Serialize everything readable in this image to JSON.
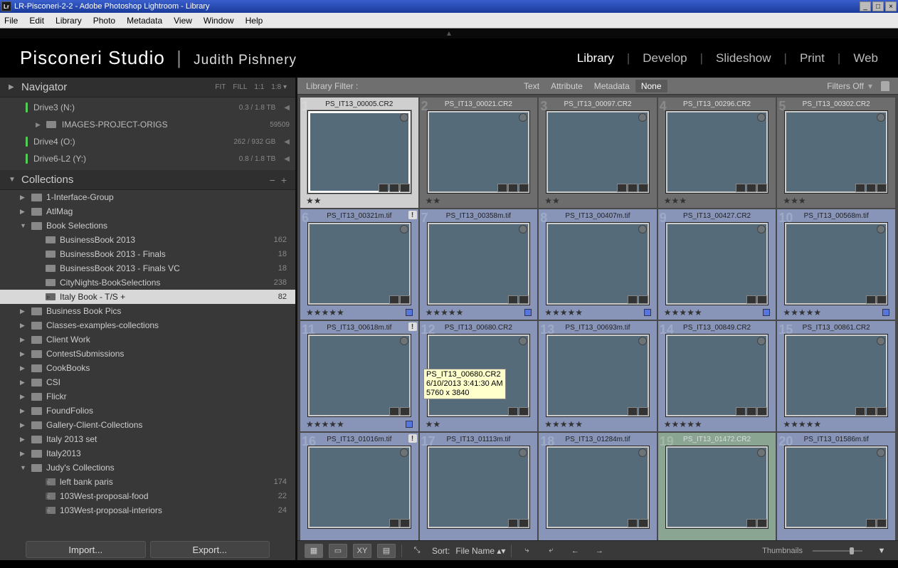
{
  "window": {
    "title": "LR-Pisconeri-2-2 - Adobe Photoshop Lightroom - Library",
    "logo": "Lr"
  },
  "menu": [
    "File",
    "Edit",
    "Library",
    "Photo",
    "Metadata",
    "View",
    "Window",
    "Help"
  ],
  "header": {
    "studio": "Pisconeri Studio",
    "author": "Judith Pishnery"
  },
  "modules": [
    "Library",
    "Develop",
    "Slideshow",
    "Print",
    "Web"
  ],
  "navigator": {
    "title": "Navigator",
    "opts": [
      "FIT",
      "FILL",
      "1:1",
      "1:8"
    ]
  },
  "drives": [
    {
      "name": "Drive3 (N:)",
      "cap": "0.3 / 1.8 TB"
    },
    {
      "name": "IMAGES-PROJECT-ORIGS",
      "count": "59509",
      "sub": true
    },
    {
      "name": "Drive4 (O:)",
      "cap": "262 / 932 GB"
    },
    {
      "name": "Drive6-L2 (Y:)",
      "cap": "0.8 / 1.8 TB"
    }
  ],
  "collections": {
    "title": "Collections",
    "items": [
      {
        "name": "1-Interface-Group",
        "level": 0,
        "tri": "▶"
      },
      {
        "name": "AtlMag",
        "level": 0,
        "tri": "▶"
      },
      {
        "name": "Book Selections",
        "level": 0,
        "tri": "▼"
      },
      {
        "name": "BusinessBook 2013",
        "count": "162",
        "level": 1
      },
      {
        "name": "BusinessBook 2013 - Finals",
        "count": "18",
        "level": 1
      },
      {
        "name": "BusinessBook 2013 - Finals VC",
        "count": "18",
        "level": 1
      },
      {
        "name": "CityNights-BookSelections",
        "count": "238",
        "level": 1
      },
      {
        "name": "Italy Book - T/S  +",
        "count": "82",
        "level": 1,
        "sel": true
      },
      {
        "name": "Business Book Pics",
        "level": 0,
        "tri": "▶"
      },
      {
        "name": "Classes-examples-collections",
        "level": 0,
        "tri": "▶"
      },
      {
        "name": "Client Work",
        "level": 0,
        "tri": "▶"
      },
      {
        "name": "ContestSubmissions",
        "level": 0,
        "tri": "▶"
      },
      {
        "name": "CookBooks",
        "level": 0,
        "tri": "▶"
      },
      {
        "name": "CSI",
        "level": 0,
        "tri": "▶"
      },
      {
        "name": "Flickr",
        "level": 0,
        "tri": "▶"
      },
      {
        "name": "FoundFolios",
        "level": 0,
        "tri": "▶"
      },
      {
        "name": "Gallery-Client-Collections",
        "level": 0,
        "tri": "▶"
      },
      {
        "name": "Italy 2013 set",
        "level": 0,
        "tri": "▶"
      },
      {
        "name": "Italy2013",
        "level": 0,
        "tri": "▶"
      },
      {
        "name": "Judy's Collections",
        "level": 0,
        "tri": "▼"
      },
      {
        "name": "left bank paris",
        "count": "174",
        "level": 1,
        "smart": true
      },
      {
        "name": "103West-proposal-food",
        "count": "22",
        "level": 1,
        "smart": true
      },
      {
        "name": "103West-proposal-interiors",
        "count": "24",
        "level": 1,
        "smart": true
      }
    ]
  },
  "buttons": {
    "import": "Import...",
    "export": "Export..."
  },
  "filter": {
    "label": "Library Filter :",
    "opts": [
      "Text",
      "Attribute",
      "Metadata",
      "None"
    ],
    "sel": 3,
    "off": "Filters Off"
  },
  "thumbs": [
    {
      "idx": "1",
      "fn": "PS_IT13_00005.CR2",
      "stars": 2,
      "th": "th-sky",
      "badges": 3,
      "active": true
    },
    {
      "idx": "2",
      "fn": "PS_IT13_00021.CR2",
      "stars": 2,
      "th": "th-wall",
      "badges": 3
    },
    {
      "idx": "3",
      "fn": "PS_IT13_00097.CR2",
      "stars": 2,
      "th": "th-yellow",
      "badges": 3
    },
    {
      "idx": "4",
      "fn": "PS_IT13_00296.CR2",
      "stars": 3,
      "th": "th-stone",
      "badges": 3
    },
    {
      "idx": "5",
      "fn": "PS_IT13_00302.CR2",
      "stars": 3,
      "th": "th-arch",
      "badges": 3
    },
    {
      "idx": "6",
      "fn": "PS_IT13_00321m.tif",
      "stars": 5,
      "th": "th-tree",
      "badges": 2,
      "sel": true,
      "excl": true,
      "sq": true
    },
    {
      "idx": "7",
      "fn": "PS_IT13_00358m.tif",
      "stars": 5,
      "th": "th-door",
      "badges": 2,
      "sel": true,
      "sq": true
    },
    {
      "idx": "8",
      "fn": "PS_IT13_00407m.tif",
      "stars": 5,
      "th": "th-cafe",
      "badges": 2,
      "sel": true,
      "sq": true
    },
    {
      "idx": "9",
      "fn": "PS_IT13_00427.CR2",
      "stars": 5,
      "th": "th-gold",
      "badges": 2,
      "sel": true,
      "sq": true
    },
    {
      "idx": "10",
      "fn": "PS_IT13_00568m.tif",
      "stars": 5,
      "th": "th-street",
      "badges": 2,
      "sel": true,
      "sq": true
    },
    {
      "idx": "11",
      "fn": "PS_IT13_00618m.tif",
      "stars": 5,
      "th": "th-station",
      "badges": 2,
      "sel": true,
      "excl": true,
      "sq": true
    },
    {
      "idx": "12",
      "fn": "PS_IT13_00680.CR2",
      "stars": 2,
      "th": "th-rose",
      "badges": 2,
      "sel": true,
      "dots": true
    },
    {
      "idx": "13",
      "fn": "PS_IT13_00693m.tif",
      "stars": 5,
      "th": "th-court",
      "badges": 2,
      "sel": true
    },
    {
      "idx": "14",
      "fn": "PS_IT13_00849.CR2",
      "stars": 5,
      "th": "th-church",
      "badges": 3,
      "sel": true
    },
    {
      "idx": "15",
      "fn": "PS_IT13_00861.CR2",
      "stars": 5,
      "th": "th-cols",
      "badges": 3,
      "sel": true
    },
    {
      "idx": "16",
      "fn": "PS_IT13_01016m.tif",
      "th": "th-statue",
      "badges": 2,
      "sel": true,
      "excl": true
    },
    {
      "idx": "17",
      "fn": "PS_IT13_01113m.tif",
      "th": "th-green",
      "badges": 2,
      "sel": true
    },
    {
      "idx": "18",
      "fn": "PS_IT13_01284m.tif",
      "th": "th-truck",
      "badges": 2,
      "sel": true
    },
    {
      "idx": "19",
      "fn": "PS_IT13_01472.CR2",
      "th": "th-shop",
      "badges": 2,
      "greenish": true
    },
    {
      "idx": "20",
      "fn": "PS_IT13_01586m.tif",
      "th": "th-tables",
      "badges": 2,
      "sel": true
    }
  ],
  "tooltip": {
    "l1": "PS_IT13_00680.CR2",
    "l2": "6/10/2013 3:41:30 AM",
    "l3": "5760 x 3840"
  },
  "toolbar": {
    "sort": "Sort:",
    "sortfield": "File Name",
    "thumbs_label": "Thumbnails"
  }
}
